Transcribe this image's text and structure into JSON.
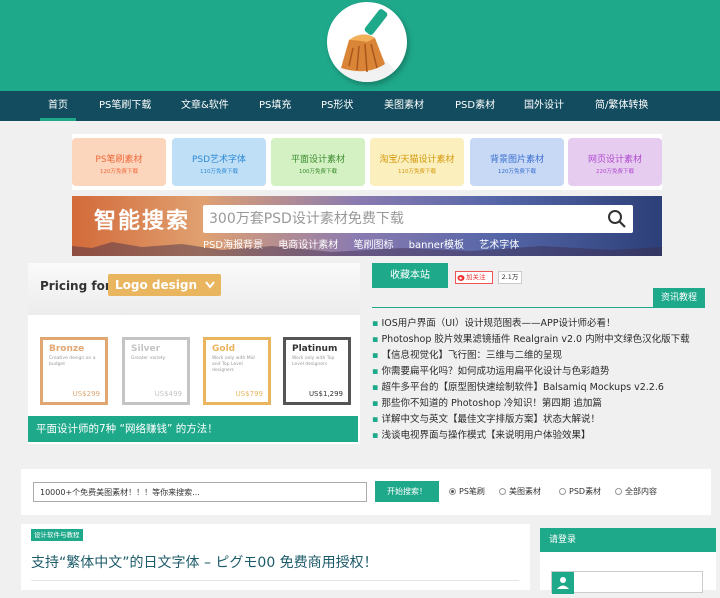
{
  "nav": {
    "items": [
      {
        "label": "首页",
        "active": true
      },
      {
        "label": "PS笔刷下载"
      },
      {
        "label": "文章&软件"
      },
      {
        "label": "PS填充"
      },
      {
        "label": "PS形状"
      },
      {
        "label": "美图素材"
      },
      {
        "label": "PSD素材"
      },
      {
        "label": "国外设计"
      },
      {
        "label": "简/繁体转换"
      }
    ]
  },
  "categories": [
    {
      "title": "PS笔刷素材",
      "sub": "120万免费下载",
      "bg": "#fcd5bd",
      "color": "#ee6a3b"
    },
    {
      "title": "PSD艺术字体",
      "sub": "110万免费下载",
      "bg": "#bfdff7",
      "color": "#2f8ad4"
    },
    {
      "title": "平面设计素材",
      "sub": "100万免费下载",
      "bg": "#d4f1c4",
      "color": "#3a8b2d"
    },
    {
      "title": "淘宝/天猫设计素材",
      "sub": "110万免费下载",
      "bg": "#fbefbe",
      "color": "#d49a0d"
    },
    {
      "title": "背景图片素材",
      "sub": "120万免费下载",
      "bg": "#c8d9f6",
      "color": "#3a6fd0"
    },
    {
      "title": "网页设计素材",
      "sub": "220万免费下载",
      "bg": "#e6cdef",
      "color": "#b048cf"
    }
  ],
  "banner": {
    "title": "智能搜索",
    "search_placeholder": "300万套PSD设计素材免费下载",
    "tags": [
      "PSD海报背景",
      "电商设计素材",
      "笔刷图标",
      "banner模板",
      "艺术字体"
    ]
  },
  "pricing": {
    "label": "Pricing for",
    "dropdown": "Logo design",
    "plans": [
      {
        "name": "Bronze",
        "desc": "Creative design on a budget",
        "price": "US$299",
        "color": "#e1a773"
      },
      {
        "name": "Silver",
        "desc": "Greater variety",
        "price": "US$499",
        "color": "#c4c4c4"
      },
      {
        "name": "Gold",
        "desc": "Work only with Mid and Top Level designers",
        "price": "US$799",
        "color": "#e9b55e"
      },
      {
        "name": "Platinum",
        "desc": "Work only with Top Level designers",
        "price": "US$1,299",
        "color": "#555555"
      }
    ],
    "caption": "平面设计师的7种 “网络赚钱” 的方法！"
  },
  "news": {
    "fav_label": "收藏本站",
    "follow_label": "加关注",
    "follow_count": "2.1万",
    "header": "资讯教程",
    "items": [
      "IOS用户界面（UI）设计规范图表——APP设计师必看！",
      "Photoshop 胶片效果滤镜插件 Realgrain v2.0 内附中文绿色汉化版下载",
      "【信息视觉化】飞行图：三维与二维的呈现",
      "你需要扁平化吗？如何成功运用扁平化设计与色彩趋势",
      "超牛多平台的【原型图快速绘制软件】Balsamiq Mockups v2.2.6",
      "那些你不知道的 Photoshop 冷知识！第四期 追加篇",
      "详解中文与英文【最佳文字排版方案】状态大解说！",
      "浅谈电视界面与操作模式【来说明用户体验效果】"
    ]
  },
  "site_search": {
    "input_value": "10000+个免费美图素材！！！等你来搜索...",
    "button": "开始搜索！",
    "options": [
      {
        "label": "PS笔刷",
        "checked": true
      },
      {
        "label": "美图素材",
        "checked": false
      },
      {
        "label": "PSD素材",
        "checked": false
      },
      {
        "label": "全部内容",
        "checked": false
      }
    ]
  },
  "article": {
    "tag": "设计软件与教程",
    "title": "支持“繁体中文”的日文字体 – ピグモ00 免费商用授权！"
  },
  "login": {
    "header": "请登录"
  }
}
